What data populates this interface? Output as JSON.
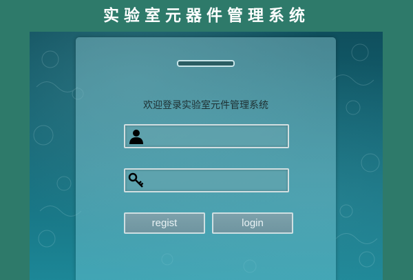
{
  "banner": {
    "title": "实验室元器件管理系统"
  },
  "login_panel": {
    "welcome": "欢迎登录实验室元件管理系统",
    "username": {
      "value": "",
      "placeholder": "",
      "icon": "user-icon"
    },
    "password": {
      "value": "",
      "placeholder": "",
      "icon": "key-icon"
    },
    "buttons": {
      "regist_label": "regist",
      "login_label": "login"
    }
  },
  "colors": {
    "outer_background": "#2e7a6a",
    "backdrop_top": "#0f4f5d",
    "backdrop_bottom": "#1c8797",
    "button_fill": "#7da1ab"
  }
}
